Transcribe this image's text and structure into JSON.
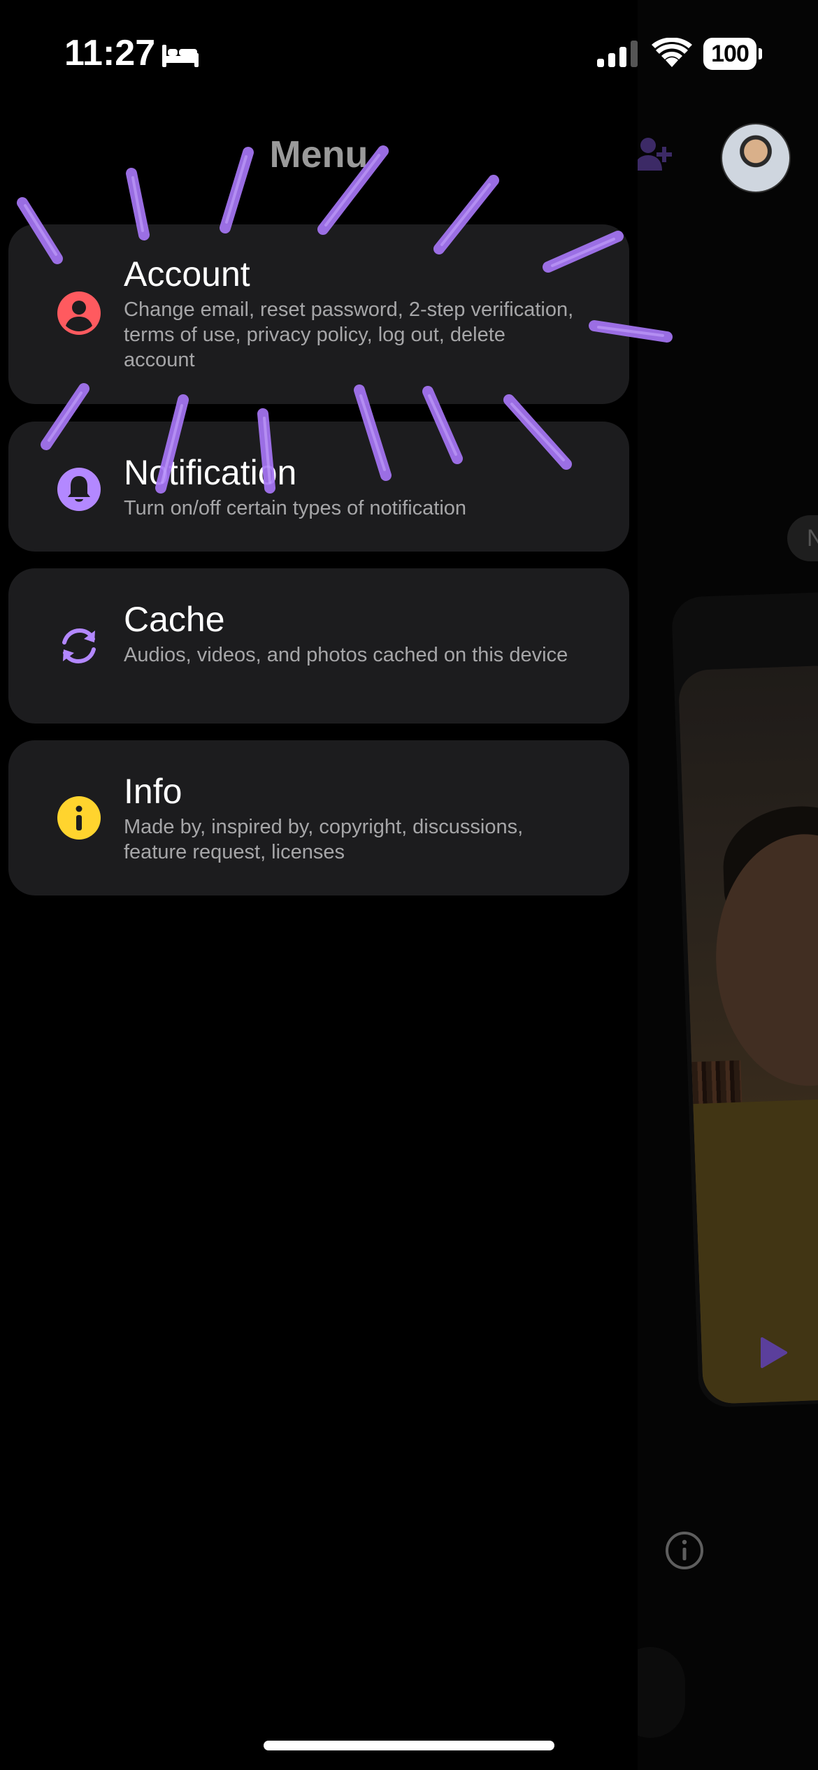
{
  "status_bar": {
    "time": "11:27",
    "battery": "100",
    "focus_icon": "bed-icon",
    "signal_icon": "cellular-signal-icon",
    "wifi_icon": "wifi-icon"
  },
  "drawer": {
    "title": "Menu",
    "items": [
      {
        "label": "Account",
        "description": "Change email, reset password, 2-step verification, terms of use, privacy policy, log out, delete account",
        "icon": "account-icon",
        "icon_color": "#ff5a5f"
      },
      {
        "label": "Notification",
        "description": "Turn on/off certain types of notification",
        "icon": "bell-icon",
        "icon_color": "#b388ff"
      },
      {
        "label": "Cache",
        "description": "Audios, videos, and photos cached on this device",
        "icon": "refresh-icon",
        "icon_color": "#b388ff"
      },
      {
        "label": "Info",
        "description": "Made by, inspired by, copyright, discussions, feature request, licenses",
        "icon": "info-icon",
        "icon_color": "#ffd42e"
      }
    ]
  },
  "background_app": {
    "pill_text": "N",
    "icons": [
      "add-friend-icon",
      "avatar",
      "play-icon",
      "info-outline-icon"
    ]
  },
  "colors": {
    "accent_purple": "#9c6cf2",
    "card_background": "#1c1c1e",
    "scribble_purple": "#a676f5"
  }
}
